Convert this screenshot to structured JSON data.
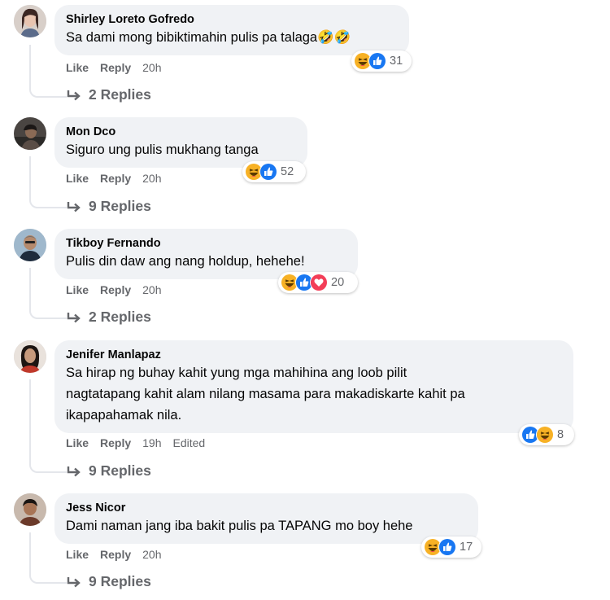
{
  "comments": [
    {
      "author": "Shirley Loreto Gofredo",
      "text": "Sa dami mong bibiktimahin pulis pa talaga🤣🤣",
      "like": "Like",
      "reply": "Reply",
      "time": "20h",
      "edited": "",
      "reaction_count": "31",
      "reaction_icons": [
        "haha-icon",
        "like-icon"
      ],
      "replies": "2 Replies"
    },
    {
      "author": "Mon Dco",
      "text": "Siguro ung pulis mukhang tanga",
      "like": "Like",
      "reply": "Reply",
      "time": "20h",
      "edited": "",
      "reaction_count": "52",
      "reaction_icons": [
        "haha-icon",
        "like-icon"
      ],
      "replies": "9 Replies"
    },
    {
      "author": "Tikboy Fernando",
      "text": "Pulis din daw ang nang holdup, hehehe!",
      "like": "Like",
      "reply": "Reply",
      "time": "20h",
      "edited": "",
      "reaction_count": "20",
      "reaction_icons": [
        "haha-icon",
        "like-icon",
        "love-icon"
      ],
      "replies": "2 Replies"
    },
    {
      "author": "Jenifer Manlapaz",
      "text_lines": [
        "Sa hirap ng buhay kahit yung mga mahihina ang loob pilit",
        "nagtatapang kahit alam nilang masama para makadiskarte kahit pa",
        "ikapapahamak nila."
      ],
      "like": "Like",
      "reply": "Reply",
      "time": "19h",
      "edited": "Edited",
      "reaction_count": "8",
      "reaction_icons": [
        "like-icon",
        "haha-icon"
      ],
      "replies": "9 Replies"
    },
    {
      "author": "Jess Nicor",
      "text": "Dami naman jang iba bakit pulis pa TAPANG mo boy hehe",
      "like": "Like",
      "reply": "Reply",
      "time": "20h",
      "edited": "",
      "reaction_count": "17",
      "reaction_icons": [
        "haha-icon",
        "like-icon"
      ],
      "replies": "9 Replies"
    }
  ],
  "colors": {
    "bubble": "#f0f2f5",
    "secondary_text": "#65676b",
    "like_blue": "#1877f2",
    "haha_yellow": "#f7b125",
    "love_red": "#f33e58"
  }
}
